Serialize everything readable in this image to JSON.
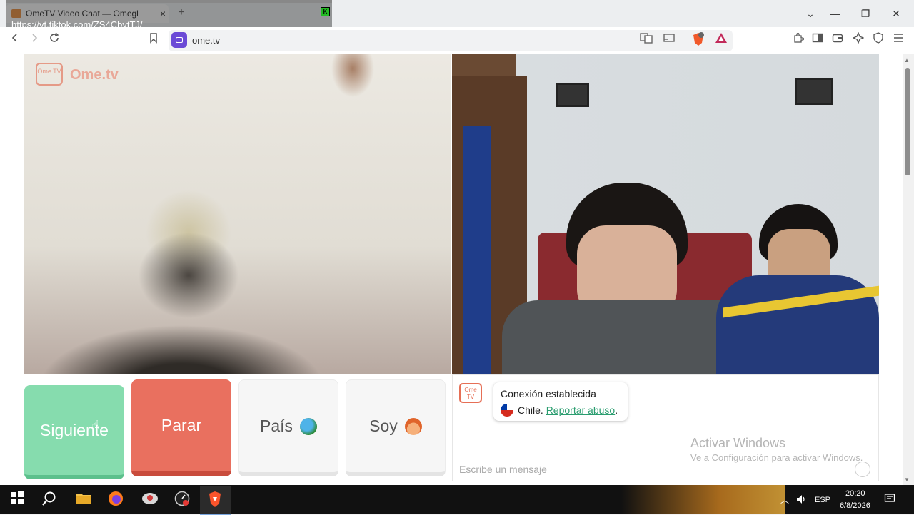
{
  "browser": {
    "tab_title": "OmeTV Video Chat — Omegl",
    "tab_close": "×",
    "new_tab": "+",
    "address": "ome.tv",
    "overlay_url": "https://vt.tiktok.com/ZS4CbytTJ/",
    "overlay_badge": "K",
    "win_controls": {
      "chevron": "⌄",
      "minimize": "—",
      "restore": "❐",
      "close": "✕"
    }
  },
  "toolbar_icons": [
    "back-icon",
    "forward-icon",
    "reload-icon",
    "bookmark-icon",
    "translate-icon",
    "cast-icon",
    "brave-shield-icon",
    "brave-rewards-icon",
    "extensions-icon",
    "sidebar-icon",
    "wallet-icon",
    "leo-icon",
    "vpn-icon",
    "menu-icon"
  ],
  "site": {
    "logo_icon_text": "Ome TV",
    "logo_text": "Ome.tv"
  },
  "controls": {
    "next": "Siguiente",
    "stop": "Parar",
    "country": "País",
    "me": "Soy"
  },
  "chat": {
    "logo_icon_text": "Ome TV",
    "connection": "Conexión establecida",
    "country": "Chile.",
    "report": "Reportar abuso",
    "report_suffix": ".",
    "placeholder": "Escribe un mensaje"
  },
  "watermark": {
    "title": "Activar Windows",
    "subtitle": "Ve a Configuración para activar Windows."
  },
  "taskbar": {
    "apps": [
      "windows-start-icon",
      "search-icon",
      "file-explorer-icon",
      "firefox-icon",
      "app-icon",
      "speedometer-icon",
      "brave-icon"
    ],
    "lang": "ESP",
    "time": "20:20",
    "date": "6/8/2026"
  },
  "colors": {
    "next": "#86dcae",
    "stop": "#e9705f",
    "link": "#2a9d6f",
    "brand": "#e66f56"
  }
}
